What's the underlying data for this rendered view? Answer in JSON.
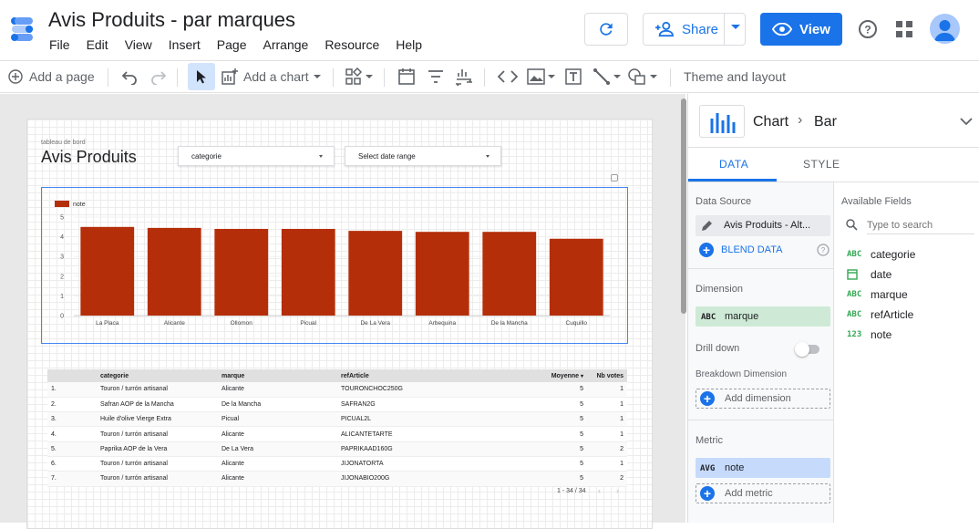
{
  "header": {
    "title": "Avis Produits - par marques",
    "menu": [
      "File",
      "Edit",
      "View",
      "Insert",
      "Page",
      "Arrange",
      "Resource",
      "Help"
    ],
    "share_label": "Share",
    "view_label": "View"
  },
  "toolbar": {
    "add_page": "Add a page",
    "add_chart": "Add a chart",
    "theme_layout": "Theme and layout"
  },
  "report": {
    "subtitle": "tableau de bord",
    "title": "Avis Produits",
    "filter_categorie": "categorie",
    "filter_date": "Select date range"
  },
  "chart_data": {
    "type": "bar",
    "categories": [
      "La Placa",
      "Alicante",
      "Ollomon",
      "Picual",
      "De La Vera",
      "Arbequina",
      "De la Mancha",
      "Cuquillo"
    ],
    "series": [
      {
        "name": "note",
        "values": [
          4.5,
          4.45,
          4.4,
          4.4,
          4.3,
          4.25,
          4.25,
          3.9
        ]
      }
    ],
    "ylim": [
      0,
      5
    ],
    "yticks": [
      0,
      1,
      2,
      3,
      4,
      5
    ],
    "color": "#b52e0a"
  },
  "table": {
    "columns": [
      "categorie",
      "marque",
      "refArticle",
      "Moyenne",
      "Nb votes"
    ],
    "rows": [
      [
        "1.",
        "Touron / turrón artisanal",
        "Alicante",
        "TOURONCHOC250G",
        "5",
        "1"
      ],
      [
        "2.",
        "Safran AOP de la Mancha",
        "De la Mancha",
        "SAFRAN2G",
        "5",
        "1"
      ],
      [
        "3.",
        "Huile d'olive Vierge Extra",
        "Picual",
        "PICUAL2L",
        "5",
        "1"
      ],
      [
        "4.",
        "Touron / turrón artisanal",
        "Alicante",
        "ALICANTETARTE",
        "5",
        "1"
      ],
      [
        "5.",
        "Paprika AOP de la Vera",
        "De La Vera",
        "PAPRIKAAD160G",
        "5",
        "2"
      ],
      [
        "6.",
        "Touron / turrón artisanal",
        "Alicante",
        "JIJONATORTA",
        "5",
        "1"
      ],
      [
        "7.",
        "Touron / turrón artisanal",
        "Alicante",
        "JIJONABIO200G",
        "5",
        "2"
      ]
    ],
    "pagination": "1 - 34 / 34"
  },
  "panel": {
    "chart_label": "Chart",
    "chart_type": "Bar",
    "tab_data": "DATA",
    "tab_style": "STYLE",
    "data_source_label": "Data Source",
    "data_source": "Avis Produits - Alt...",
    "blend_data": "BLEND DATA",
    "dimension_label": "Dimension",
    "dimension_type": "ABC",
    "dimension_value": "marque",
    "drill_down": "Drill down",
    "breakdown_label": "Breakdown Dimension",
    "add_dimension": "Add dimension",
    "metric_label": "Metric",
    "metric_type": "AVG",
    "metric_value": "note",
    "add_metric": "Add metric",
    "available_fields_label": "Available Fields",
    "search_placeholder": "Type to search",
    "fields": [
      {
        "type": "ABC",
        "name": "categorie"
      },
      {
        "type": "date",
        "name": "date"
      },
      {
        "type": "ABC",
        "name": "marque"
      },
      {
        "type": "ABC",
        "name": "refArticle"
      },
      {
        "type": "123",
        "name": "note"
      }
    ]
  }
}
